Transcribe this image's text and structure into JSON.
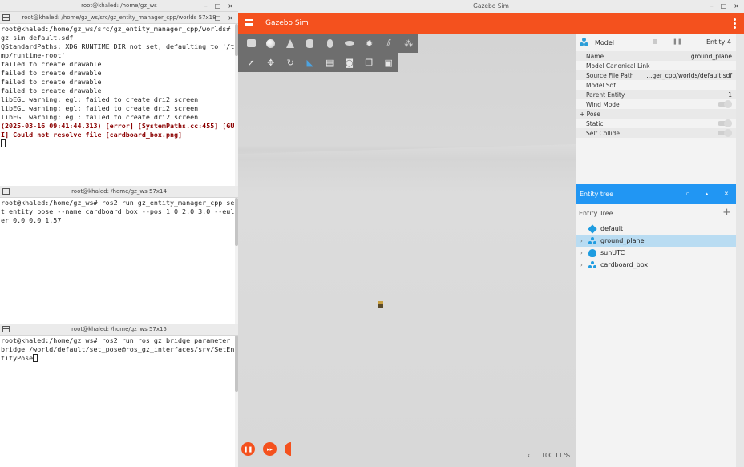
{
  "terminals": [
    {
      "title": "root@khaled: /home/gz_ws",
      "lines": []
    },
    {
      "title": "root@khaled: /home/gz_ws/src/gz_entity_manager_cpp/worlds 57x18",
      "lines": [
        "root@khaled:/home/gz_ws/src/gz_entity_manager_cpp/worlds# gz sim default.sdf",
        "QStandardPaths: XDG_RUNTIME_DIR not set, defaulting to '/tmp/runtime-root'",
        "failed to create drawable",
        "failed to create drawable",
        "failed to create drawable",
        "failed to create drawable",
        "libEGL warning: egl: failed to create dri2 screen",
        "libEGL warning: egl: failed to create dri2 screen",
        "libEGL warning: egl: failed to create dri2 screen"
      ],
      "error": "(2025-03-16 09:41:44.313) [error] [SystemPaths.cc:455] [GUI] Could not resolve file [cardboard_box.png]"
    },
    {
      "title": "root@khaled: /home/gz_ws 57x14",
      "lines": [
        "root@khaled:/home/gz_ws# ros2 run gz_entity_manager_cpp set_entity_pose --name cardboard_box --pos 1.0 2.0 3.0 --euler 0.0 0.0 1.57"
      ]
    },
    {
      "title": "root@khaled: /home/gz_ws 57x15",
      "lines": [
        "root@khaled:/home/gz_ws# ros2 run ros_gz_bridge parameter_bridge /world/default/set_pose@ros_gz_interfaces/srv/SetEntityPose"
      ]
    }
  ],
  "gazebo": {
    "window_title": "Gazebo Sim",
    "app_title": "Gazebo Sim",
    "rtf": "100.11 %",
    "accent": "#f4511e",
    "toolbar_shapes": [
      "box-icon",
      "sphere-icon",
      "cone-icon",
      "cylinder-icon",
      "capsule-icon",
      "ellipsoid-icon",
      "sun-icon",
      "directional-light-icon",
      "spot-light-icon"
    ],
    "toolbar_tools": [
      "select-icon",
      "translate-icon",
      "rotate-icon",
      "snap-icon",
      "grid-icon",
      "camera-icon",
      "copy-icon",
      "paste-icon"
    ]
  },
  "component_inspector": {
    "title": "Model",
    "entity": "Entity 4",
    "rows": [
      {
        "key": "Name",
        "value": "ground_plane"
      },
      {
        "key": "Model Canonical Link",
        "value": ""
      },
      {
        "key": "Source File Path",
        "value": "...ger_cpp/worlds/default.sdf"
      },
      {
        "key": "Model Sdf",
        "value": ""
      },
      {
        "key": "Parent Entity",
        "value": "1"
      },
      {
        "key": "Wind Mode",
        "value": "",
        "toggle": true
      },
      {
        "key": "+ Pose",
        "value": ""
      },
      {
        "key": "Static",
        "value": "",
        "toggle": true
      },
      {
        "key": "Self Collide",
        "value": "",
        "toggle": true
      }
    ]
  },
  "entity_tree": {
    "header": "Entity tree",
    "label": "Entity Tree",
    "items": [
      {
        "name": "default",
        "icon": "cube-icon",
        "expandable": false
      },
      {
        "name": "ground_plane",
        "icon": "model-icon",
        "expandable": true,
        "selected": true
      },
      {
        "name": "sunUTC",
        "icon": "light-icon",
        "expandable": true
      },
      {
        "name": "cardboard_box",
        "icon": "model-icon",
        "expandable": true
      }
    ],
    "accent": "#2196f3"
  }
}
